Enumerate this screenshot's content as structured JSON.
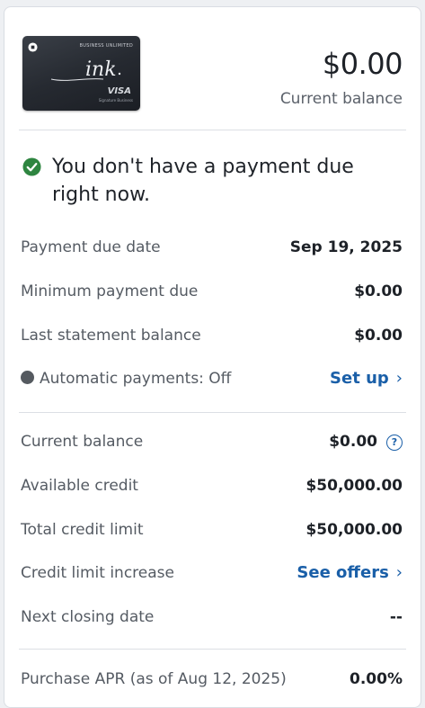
{
  "card_image": {
    "brand_text": "BUSINESS UNLIMITED",
    "script_text": "ink",
    "network": "VISA",
    "network_sub": "Signature Business"
  },
  "balance": {
    "amount": "$0.00",
    "label": "Current balance"
  },
  "notice": {
    "icon": "check-circle-icon",
    "message": "You don't have a payment due right now."
  },
  "payment_section": [
    {
      "label": "Payment due date",
      "value": "Sep 19, 2025"
    },
    {
      "label": "Minimum payment due",
      "value": "$0.00"
    },
    {
      "label": "Last statement balance",
      "value": "$0.00"
    }
  ],
  "autopay": {
    "label": "Automatic payments: Off",
    "link": "Set up",
    "chevron": "›"
  },
  "credit_section": {
    "current_balance": {
      "label": "Current balance",
      "value": "$0.00",
      "help": "?"
    },
    "available_credit": {
      "label": "Available credit",
      "value": "$50,000.00"
    },
    "total_limit": {
      "label": "Total credit limit",
      "value": "$50,000.00"
    },
    "limit_increase": {
      "label": "Credit limit increase",
      "link": "See offers",
      "chevron": "›"
    },
    "next_closing": {
      "label": "Next closing date",
      "value": "--"
    }
  },
  "apr": {
    "label": "Purchase APR (as of Aug 12, 2025)",
    "value": "0.00%"
  },
  "colors": {
    "link": "#1a5fa8",
    "success": "#2e8540",
    "text": "#1d2127",
    "muted": "#555b63"
  }
}
